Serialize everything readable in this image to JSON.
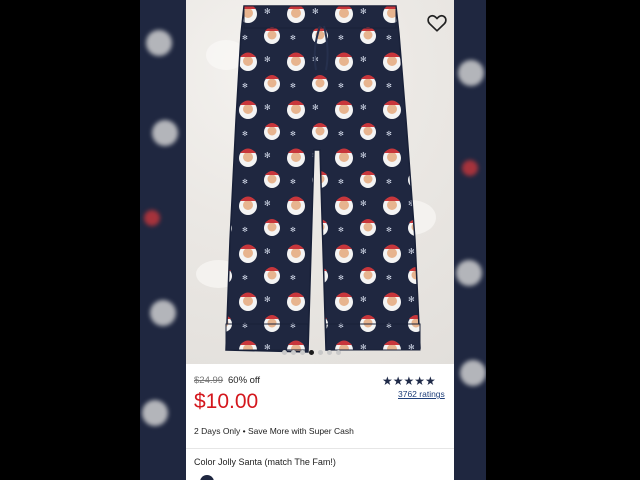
{
  "product": {
    "original_price": "$24.99",
    "discount": "60% off",
    "sale_price": "$10.00",
    "rating_stars": "★★★★★",
    "ratings_count": "3762 ratings",
    "promo": "2 Days Only • Save More with Super Cash",
    "color_label": "Color Jolly Santa (match The Fam!)"
  },
  "gallery": {
    "dots": 7,
    "active_dot": 4
  },
  "icons": {
    "favorite": "heart-outline-icon",
    "rating": "star-icon"
  },
  "colors": {
    "price_red": "#d4171d",
    "navy": "#1f2740",
    "link_blue": "#1f3f7a",
    "star": "#1f2a48"
  }
}
